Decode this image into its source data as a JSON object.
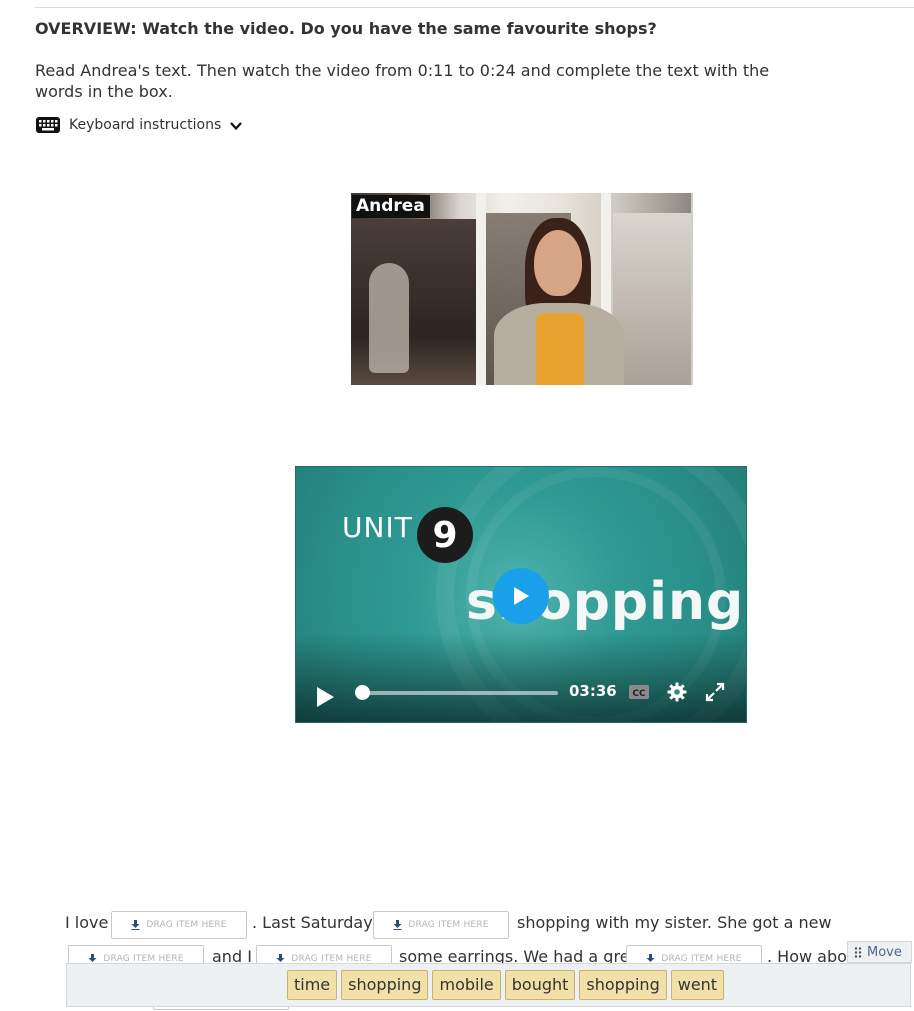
{
  "header": {
    "overview": "OVERVIEW: Watch the video. Do you have the same favourite shops?",
    "instructions": "Read Andrea's text. Then watch the video from 0:11 to 0:24 and complete the text with the words in the box.",
    "keyboard_label": "Keyboard instructions"
  },
  "image": {
    "name_tag": "Andrea"
  },
  "video": {
    "unit_label": "UNIT",
    "unit_number": "9",
    "title_word": "shopping",
    "duration": "03:36",
    "progress": 0
  },
  "exercise": {
    "line1": {
      "t1": "I love",
      "t2": ". Last Saturday I",
      "t3": "shopping with my sister. She got a new"
    },
    "line2": {
      "t1": "and I",
      "t2": "some earrings. We had a great",
      "t3": ". How abou"
    },
    "drop_placeholder": "DRAG ITEM HERE"
  },
  "word_pool": {
    "move_label": "Move",
    "words": [
      "time",
      "shopping",
      "mobile",
      "bought",
      "shopping",
      "went"
    ]
  }
}
